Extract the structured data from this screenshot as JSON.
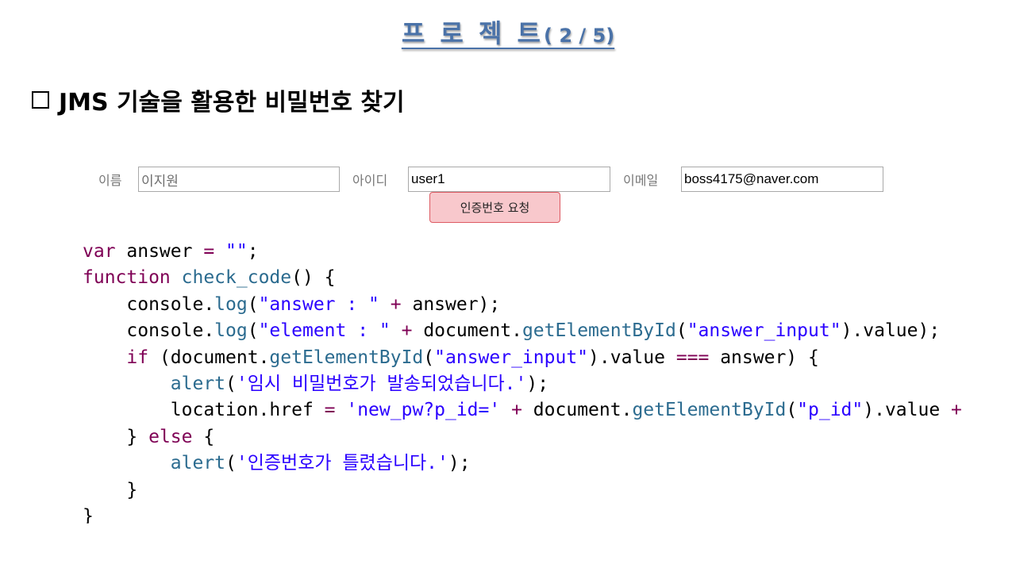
{
  "slide": {
    "title": "프 로 젝 트",
    "page_indicator": "( 2 / 5)",
    "heading": "JMS 기술을 활용한 비밀번호 찾기"
  },
  "form": {
    "name_label": "이름",
    "name_placeholder": "이지원",
    "id_label": "아이디",
    "id_value": "user1",
    "email_label": "이메일",
    "email_value": "boss4175@naver.com",
    "request_button": "인증번호 요청"
  },
  "code": {
    "lines": [
      [
        {
          "t": "var",
          "c": "kw"
        },
        {
          "t": " answer ",
          "c": "op"
        },
        {
          "t": "=",
          "c": "kw"
        },
        {
          "t": " ",
          "c": "op"
        },
        {
          "t": "\"\"",
          "c": "str"
        },
        {
          "t": ";",
          "c": "op"
        }
      ],
      [
        {
          "t": "function",
          "c": "kw"
        },
        {
          "t": " ",
          "c": "op"
        },
        {
          "t": "check_code",
          "c": "fn"
        },
        {
          "t": "() {",
          "c": "op"
        }
      ],
      [
        {
          "t": "    console.",
          "c": "op"
        },
        {
          "t": "log",
          "c": "fn"
        },
        {
          "t": "(",
          "c": "op"
        },
        {
          "t": "\"answer : \"",
          "c": "str"
        },
        {
          "t": " ",
          "c": "op"
        },
        {
          "t": "+",
          "c": "kw"
        },
        {
          "t": " answer);",
          "c": "op"
        }
      ],
      [
        {
          "t": "    console.",
          "c": "op"
        },
        {
          "t": "log",
          "c": "fn"
        },
        {
          "t": "(",
          "c": "op"
        },
        {
          "t": "\"element : \"",
          "c": "str"
        },
        {
          "t": " ",
          "c": "op"
        },
        {
          "t": "+",
          "c": "kw"
        },
        {
          "t": " document.",
          "c": "op"
        },
        {
          "t": "getElementById",
          "c": "fn"
        },
        {
          "t": "(",
          "c": "op"
        },
        {
          "t": "\"answer_input\"",
          "c": "str"
        },
        {
          "t": ").value);",
          "c": "op"
        }
      ],
      [
        {
          "t": "    ",
          "c": "op"
        },
        {
          "t": "if",
          "c": "kw"
        },
        {
          "t": " (document.",
          "c": "op"
        },
        {
          "t": "getElementById",
          "c": "fn"
        },
        {
          "t": "(",
          "c": "op"
        },
        {
          "t": "\"answer_input\"",
          "c": "str"
        },
        {
          "t": ").value ",
          "c": "op"
        },
        {
          "t": "===",
          "c": "kw"
        },
        {
          "t": " answer) {",
          "c": "op"
        }
      ],
      [
        {
          "t": "        ",
          "c": "op"
        },
        {
          "t": "alert",
          "c": "fn"
        },
        {
          "t": "(",
          "c": "op"
        },
        {
          "t": "'임시 비밀번호가 발송되었습니다.'",
          "c": "str"
        },
        {
          "t": ");",
          "c": "op"
        }
      ],
      [
        {
          "t": "        location.href ",
          "c": "op"
        },
        {
          "t": "=",
          "c": "kw"
        },
        {
          "t": " ",
          "c": "op"
        },
        {
          "t": "'new_pw?p_id='",
          "c": "str"
        },
        {
          "t": " ",
          "c": "op"
        },
        {
          "t": "+",
          "c": "kw"
        },
        {
          "t": " document.",
          "c": "op"
        },
        {
          "t": "getElementById",
          "c": "fn"
        },
        {
          "t": "(",
          "c": "op"
        },
        {
          "t": "\"p_id\"",
          "c": "str"
        },
        {
          "t": ").value ",
          "c": "op"
        },
        {
          "t": "+",
          "c": "kw"
        }
      ],
      [
        {
          "t": "    } ",
          "c": "op"
        },
        {
          "t": "else",
          "c": "kw"
        },
        {
          "t": " {",
          "c": "op"
        }
      ],
      [
        {
          "t": "        ",
          "c": "op"
        },
        {
          "t": "alert",
          "c": "fn"
        },
        {
          "t": "(",
          "c": "op"
        },
        {
          "t": "'인증번호가 틀렸습니다.'",
          "c": "str"
        },
        {
          "t": ");",
          "c": "op"
        }
      ],
      [
        {
          "t": "    }",
          "c": "op"
        }
      ],
      [
        {
          "t": "}",
          "c": "op"
        }
      ]
    ]
  }
}
